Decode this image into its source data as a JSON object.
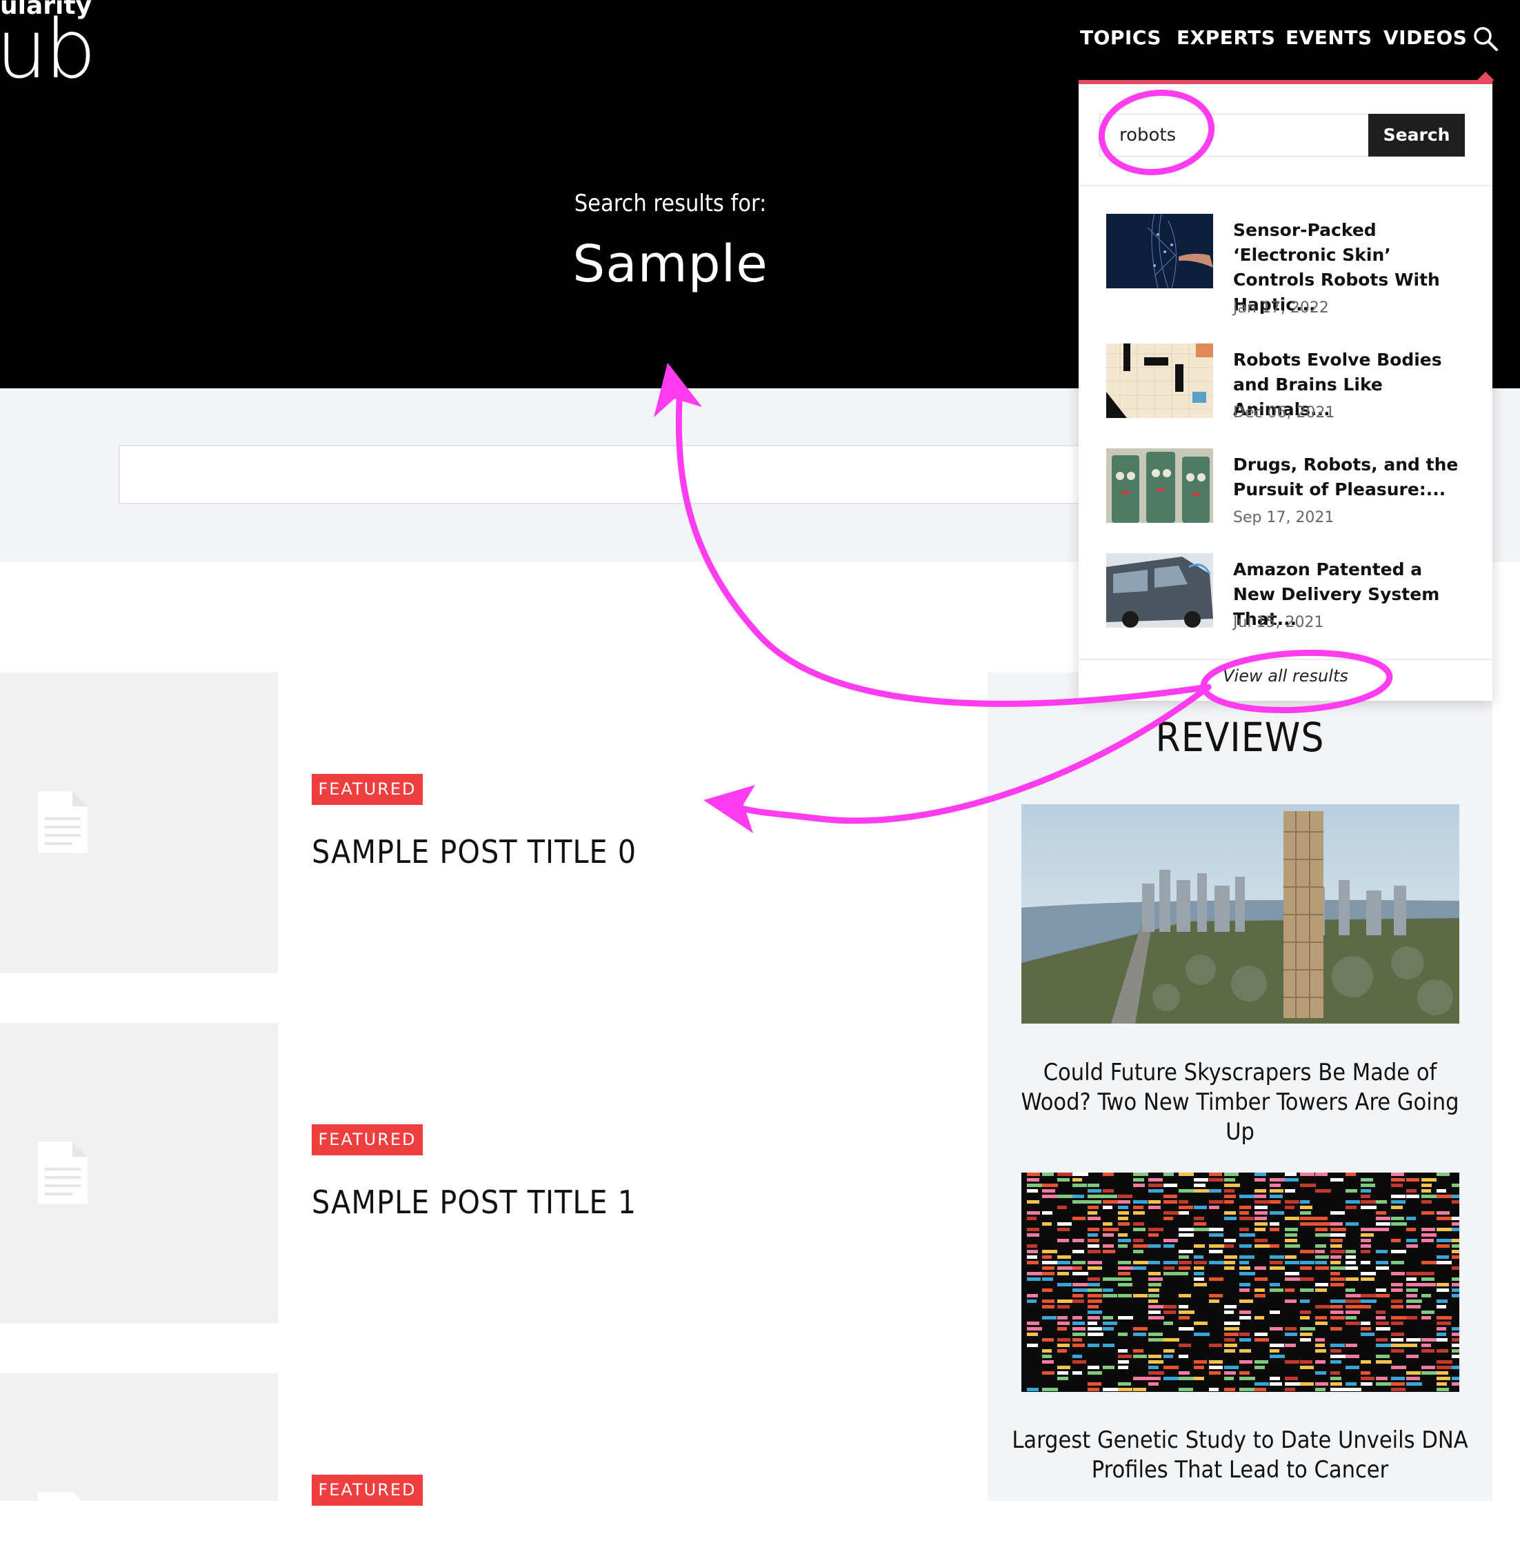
{
  "brand": {
    "logo_top": "ularity",
    "logo_main": "ub"
  },
  "nav": {
    "items": [
      "TOPICS",
      "EXPERTS",
      "EVENTS",
      "VIDEOS"
    ]
  },
  "hero": {
    "label": "Search results for:",
    "term": "Sample"
  },
  "search_dropdown": {
    "query": "robots",
    "button": "Search",
    "results": [
      {
        "title": "Sensor-Packed ‘Electronic Skin’ Controls Robots With Haptic...",
        "date": "Jan 17, 2022"
      },
      {
        "title": "Robots Evolve Bodies and Brains Like Animals...",
        "date": "Dec 06, 2021"
      },
      {
        "title": "Drugs, Robots, and the Pursuit of Pleasure:...",
        "date": "Sep 17, 2021"
      },
      {
        "title": "Amazon Patented a New Delivery System That...",
        "date": "Jul 15, 2021"
      }
    ],
    "view_all": "View all results"
  },
  "posts": [
    {
      "badge": "FEATURED",
      "title": "SAMPLE POST TITLE 0"
    },
    {
      "badge": "FEATURED",
      "title": "SAMPLE POST TITLE 1"
    },
    {
      "badge": "FEATURED",
      "title": ""
    }
  ],
  "sidebar": {
    "heading": "REVIEWS",
    "items": [
      {
        "title": "Could Future Skyscrapers Be Made of Wood? Two New Timber Towers Are Going Up"
      },
      {
        "title": "Largest Genetic Study to Date Unveils DNA Profiles That Lead to Cancer"
      }
    ]
  },
  "colors": {
    "accent": "#ef3e3e",
    "annotation": "#ff3cf0",
    "header_bg": "#000000",
    "band_bg": "#f3f4f6"
  }
}
